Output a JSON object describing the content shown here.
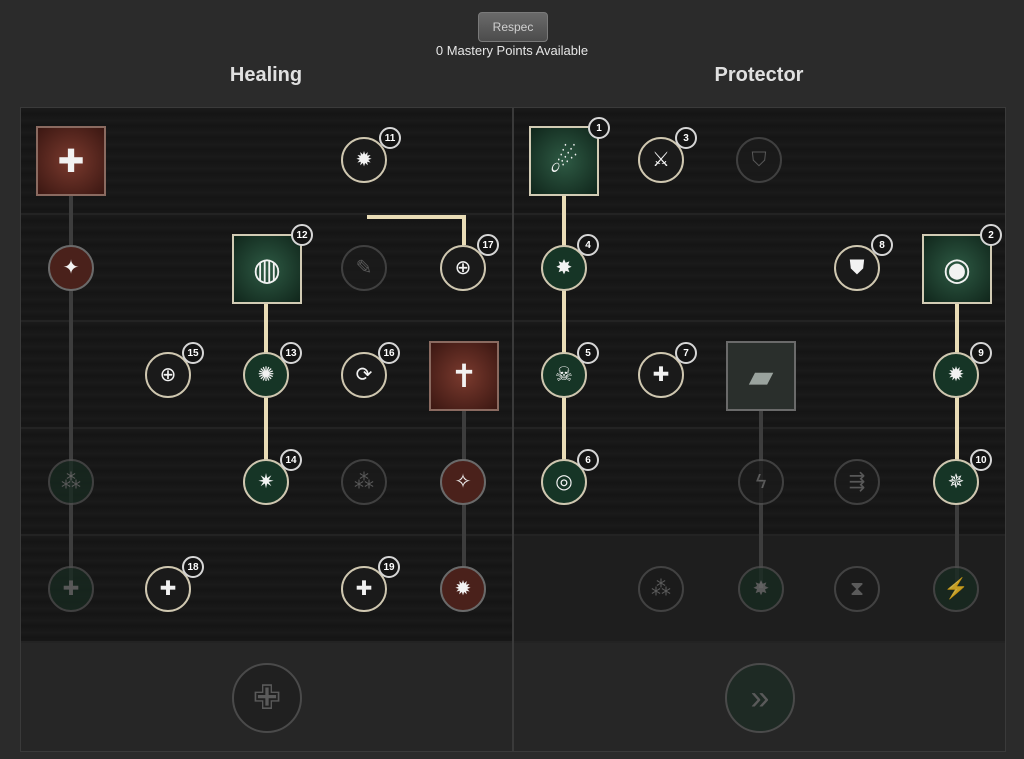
{
  "header": {
    "respec_label": "Respec",
    "points_text": "0 Mastery Points Available"
  },
  "trees": {
    "healing": "Healing",
    "protector": "Protector"
  },
  "nodes": {
    "n1": {
      "icon": "comet-icon",
      "glyph": "☄",
      "badge": "1"
    },
    "n2": {
      "icon": "aura-shield-icon",
      "glyph": "◉",
      "badge": "2"
    },
    "n3": {
      "icon": "dash-strike-icon",
      "glyph": "⚔",
      "badge": "3"
    },
    "n4": {
      "icon": "burst-icon",
      "glyph": "✸",
      "badge": "4"
    },
    "n5": {
      "icon": "skull-icon",
      "glyph": "☠",
      "badge": "5"
    },
    "n6": {
      "icon": "ring-icon",
      "glyph": "◎",
      "badge": "6"
    },
    "n7": {
      "icon": "sparkle-plus-icon",
      "glyph": "✚",
      "badge": "7"
    },
    "n8": {
      "icon": "chest-armor-icon",
      "glyph": "⛊",
      "badge": "8"
    },
    "n9": {
      "icon": "radiant-shield-icon",
      "glyph": "✹",
      "badge": "9"
    },
    "n10": {
      "icon": "star-cross-icon",
      "glyph": "✵",
      "badge": "10"
    },
    "n11": {
      "icon": "radiant-shield-icon",
      "glyph": "✹",
      "badge": "11"
    },
    "n12": {
      "icon": "orb-swirl-icon",
      "glyph": "◍",
      "badge": "12"
    },
    "n13": {
      "icon": "splash-icon",
      "glyph": "✺",
      "badge": "13"
    },
    "n14": {
      "icon": "star-shield-icon",
      "glyph": "✷",
      "badge": "14"
    },
    "n15": {
      "icon": "cross-circle-icon",
      "glyph": "⊕",
      "badge": "15"
    },
    "n16": {
      "icon": "cycle-icon",
      "glyph": "⟳",
      "badge": "16"
    },
    "n17": {
      "icon": "cross-helmet-icon",
      "glyph": "⊕",
      "badge": "17"
    },
    "n18": {
      "icon": "group-heal-icon",
      "glyph": "✚",
      "badge": "18"
    },
    "n19": {
      "icon": "plus-icon",
      "glyph": "✚",
      "badge": "19"
    },
    "h_cross": {
      "icon": "radiant-cross-icon",
      "glyph": "✚"
    },
    "h_star": {
      "icon": "star-icon",
      "glyph": "✦"
    },
    "h_network": {
      "icon": "network-icon",
      "glyph": "⁂"
    },
    "h_plus": {
      "icon": "plus-icon",
      "glyph": "✚"
    },
    "h_feather": {
      "icon": "feather-icon",
      "glyph": "✎"
    },
    "h_grouplight": {
      "icon": "group-light-icon",
      "glyph": "⁂"
    },
    "h_graveyard": {
      "icon": "group-cross-icon",
      "glyph": "✝"
    },
    "h_sparks": {
      "icon": "sparkles-icon",
      "glyph": "✧"
    },
    "h_starburst": {
      "icon": "starburst-icon",
      "glyph": "✹"
    },
    "h_cap": {
      "icon": "cross-seal-icon",
      "glyph": "✙"
    },
    "p_shield": {
      "icon": "shield-icon",
      "glyph": "⛉"
    },
    "p_slab": {
      "icon": "slab-icon",
      "glyph": "▰"
    },
    "p_lightning": {
      "icon": "lightning-icon",
      "glyph": "ϟ"
    },
    "p_runners": {
      "icon": "runners-icon",
      "glyph": "⇶"
    },
    "p_group": {
      "icon": "group-arrow-icon",
      "glyph": "⁂"
    },
    "p_burst": {
      "icon": "burst-icon",
      "glyph": "✸"
    },
    "p_hourglass": {
      "icon": "hourglass-icon",
      "glyph": "⧗"
    },
    "p_runner": {
      "icon": "runner-icon",
      "glyph": "⚡"
    },
    "p_cap": {
      "icon": "chevron-shield-icon",
      "glyph": "»"
    }
  }
}
